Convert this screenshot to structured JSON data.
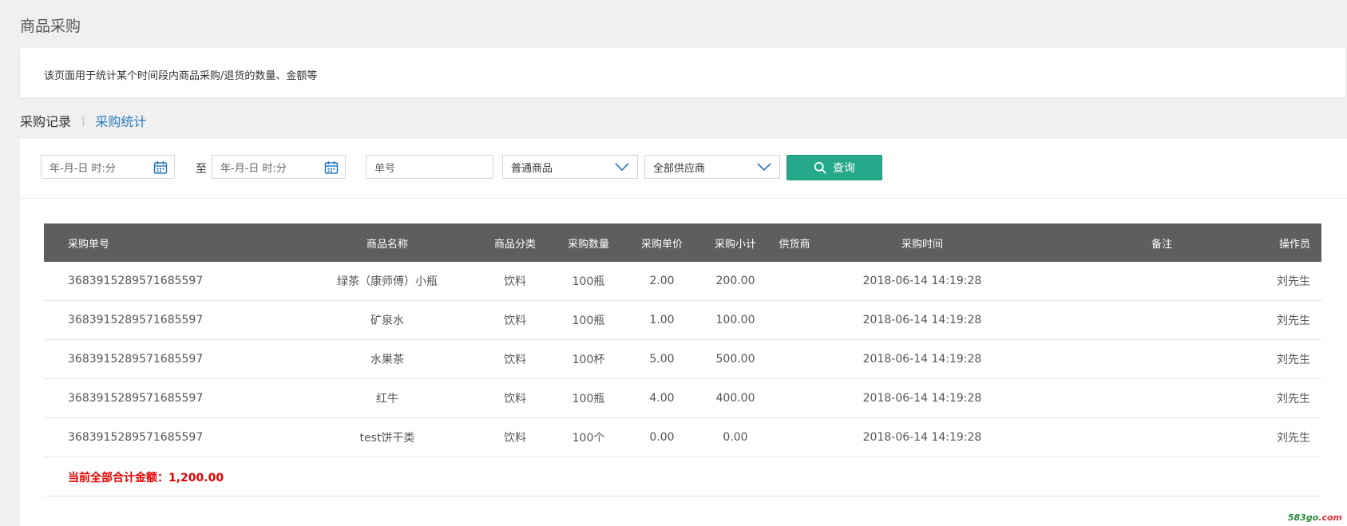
{
  "page": {
    "title": "商品采购",
    "description": "该页面用于统计某个时间段内商品采购/退货的数量、金额等"
  },
  "tabs": [
    {
      "label": "采购记录",
      "active": false
    },
    {
      "label": "采购统计",
      "active": true
    }
  ],
  "tab_separator": "|",
  "filters": {
    "start_placeholder": "年-月-日 时:分",
    "to_label": "至",
    "end_placeholder": "年-月-日 时:分",
    "order_no_placeholder": "单号",
    "product_type_selected": "普通商品",
    "supplier_selected": "全部供应商",
    "search_label": "查询"
  },
  "table": {
    "headers": [
      "采购单号",
      "商品名称",
      "商品分类",
      "采购数量",
      "采购单价",
      "采购小计",
      "供货商",
      "采购时间",
      "备注",
      "操作员"
    ],
    "rows": [
      {
        "order_no": "3683915289571685597",
        "name": "绿茶（康师傅）小瓶",
        "category": "饮料",
        "qty": "100瓶",
        "price": "2.00",
        "subtotal": "200.00",
        "supplier": "",
        "time": "2018-06-14 14:19:28",
        "note": "",
        "operator": "刘先生"
      },
      {
        "order_no": "3683915289571685597",
        "name": "矿泉水",
        "category": "饮料",
        "qty": "100瓶",
        "price": "1.00",
        "subtotal": "100.00",
        "supplier": "",
        "time": "2018-06-14 14:19:28",
        "note": "",
        "operator": "刘先生"
      },
      {
        "order_no": "3683915289571685597",
        "name": "水果茶",
        "category": "饮料",
        "qty": "100杯",
        "price": "5.00",
        "subtotal": "500.00",
        "supplier": "",
        "time": "2018-06-14 14:19:28",
        "note": "",
        "operator": "刘先生"
      },
      {
        "order_no": "3683915289571685597",
        "name": "红牛",
        "category": "饮料",
        "qty": "100瓶",
        "price": "4.00",
        "subtotal": "400.00",
        "supplier": "",
        "time": "2018-06-14 14:19:28",
        "note": "",
        "operator": "刘先生"
      },
      {
        "order_no": "3683915289571685597",
        "name": "test饼干类",
        "category": "饮料",
        "qty": "100个",
        "price": "0.00",
        "subtotal": "0.00",
        "supplier": "",
        "time": "2018-06-14 14:19:28",
        "note": "",
        "operator": "刘先生"
      }
    ],
    "total_label": "当前全部合计金额：1,200.00"
  },
  "watermark": {
    "prefix": "583go",
    "suffix": ".com"
  },
  "icons": {
    "calendar": "calendar-icon",
    "chevron": "chevron-down-icon",
    "search": "search-icon"
  },
  "colors": {
    "accent": "#26a88a",
    "active_tab": "#2a7ab8",
    "header_bg": "#5e5e5e",
    "total": "#e60000"
  }
}
